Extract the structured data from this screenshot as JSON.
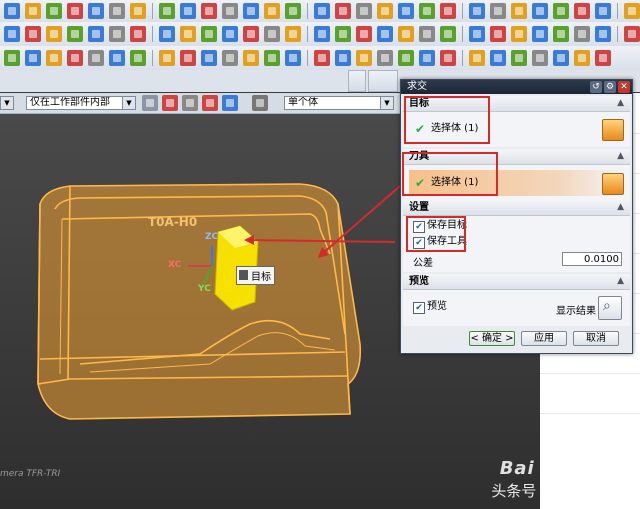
{
  "toolbar_icons": {
    "row1": [
      "#3a7bd5",
      "#e0a020",
      "#5aa02c",
      "#c44",
      "#3a7bd5",
      "#888",
      "#e0a020",
      "#5aa02c",
      "#3a7bd5",
      "#c44",
      "#888",
      "#3a7bd5",
      "#e0a020",
      "#5aa02c",
      "#3a7bd5",
      "#c44",
      "#888",
      "#e0a020",
      "#3a7bd5",
      "#5aa02c",
      "#c44",
      "#3a7bd5",
      "#888",
      "#e0a020",
      "#3a7bd5",
      "#5aa02c",
      "#c44",
      "#3a7bd5",
      "#e0a020",
      "#888",
      "#3a7bd5",
      "#5aa02c"
    ],
    "row2": [
      "#3a7bd5",
      "#c44",
      "#e0a020",
      "#5aa02c",
      "#3a7bd5",
      "#888",
      "#c44",
      "#3a7bd5",
      "#e0a020",
      "#5aa02c",
      "#3a7bd5",
      "#c44",
      "#888",
      "#e0a020",
      "#3a7bd5",
      "#5aa02c",
      "#c44",
      "#3a7bd5",
      "#e0a020",
      "#888",
      "#5aa02c",
      "#3a7bd5",
      "#c44",
      "#e0a020",
      "#3a7bd5",
      "#5aa02c",
      "#888",
      "#3a7bd5",
      "#c44",
      "#e0a020",
      "#3a7bd5"
    ],
    "row3": [
      "#5aa02c",
      "#3a7bd5",
      "#e0a020",
      "#c44",
      "#888",
      "#3a7bd5",
      "#5aa02c",
      "#e0a020",
      "#c44",
      "#3a7bd5",
      "#888",
      "#e0a020",
      "#5aa02c",
      "#3a7bd5",
      "#c44",
      "#3a7bd5",
      "#e0a020",
      "#888",
      "#5aa02c",
      "#3a7bd5",
      "#c44",
      "#e0a020",
      "#3a7bd5",
      "#5aa02c",
      "#888",
      "#3a7bd5",
      "#e0a020",
      "#c44"
    ]
  },
  "selection_bar": {
    "filter_value": "仅在工作部件内部",
    "type_value": "单个体"
  },
  "viewport": {
    "part_text": "T0A-H0",
    "axis_zc": "ZC",
    "axis_xc": "XC",
    "axis_yc": "YC",
    "target_tag": "目标",
    "camera_label": "mera TFR-TRI"
  },
  "dialog": {
    "title": "求交",
    "target": {
      "header": "目标",
      "picker_label": "选择体 (1)"
    },
    "tool": {
      "header": "刀具",
      "picker_label": "选择体 (1)"
    },
    "settings": {
      "header": "设置",
      "keep_target_label": "保存目标",
      "keep_target_checked": true,
      "keep_tool_label": "保存工具",
      "keep_tool_checked": true,
      "tolerance_label": "公差",
      "tolerance_value": "0.0100"
    },
    "preview": {
      "header": "预览",
      "preview_label": "预览",
      "preview_checked": true,
      "show_result_label": "显示结果"
    },
    "buttons": {
      "ok": "< 确定 >",
      "apply": "应用",
      "cancel": "取消"
    }
  },
  "watermarks": {
    "baidu": "Bai 经验",
    "source": "头条号 / ug模具联盟"
  },
  "colors": {
    "highlight_red": "#d42a2a",
    "part_orange": "#f0a030",
    "tool_yellow": "#f5e000"
  }
}
